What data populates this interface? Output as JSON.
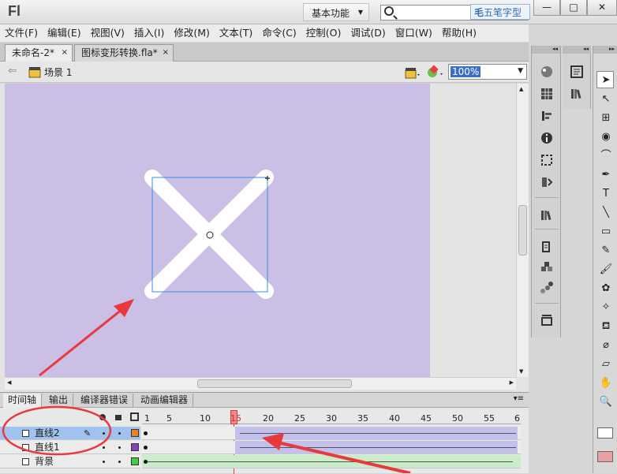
{
  "window": {
    "app_logo": "Fl",
    "workspace_label": "基本功能",
    "search_placeholder": "",
    "watermark": "五笔字型",
    "controls": {
      "minimize": "—",
      "maximize": "□",
      "close": "✕"
    }
  },
  "menubar": {
    "items": [
      "文件(F)",
      "编辑(E)",
      "视图(V)",
      "插入(I)",
      "修改(M)",
      "文本(T)",
      "命令(C)",
      "控制(O)",
      "调试(D)",
      "窗口(W)",
      "帮助(H)"
    ]
  },
  "doc_tabs": [
    {
      "label": "未命名-2*",
      "close": "×"
    },
    {
      "label": "图标变形转换.fla*",
      "close": "×"
    }
  ],
  "editbar": {
    "scene_label": "场景 1",
    "zoom": "100%"
  },
  "timeline": {
    "tabs": [
      "时间轴",
      "输出",
      "编译器错误",
      "动画编辑器"
    ],
    "ruler_numbers": [
      "1",
      "5",
      "10",
      "15",
      "20",
      "25",
      "30",
      "35",
      "40",
      "45",
      "50",
      "55",
      "6"
    ],
    "current_frame": "15",
    "layers": [
      {
        "name": "直线2",
        "color": "#e7861f",
        "selected": true
      },
      {
        "name": "直线1",
        "color": "#8b3dc4",
        "selected": false
      },
      {
        "name": "背景",
        "color": "#3fcf3f",
        "selected": false
      }
    ]
  },
  "colors": {
    "stage": "#cbbfe6",
    "annotation_red": "#e8393c",
    "selection_blue": "#3a8ee6"
  },
  "icons": {
    "tools": [
      "selection-tool-icon",
      "subselection-tool-icon",
      "free-transform-icon",
      "3d-rotation-icon",
      "lasso-icon",
      "pen-icon",
      "text-tool-icon",
      "line-tool-icon",
      "rectangle-tool-icon",
      "pencil-icon",
      "brush-icon",
      "deco-icon",
      "bone-icon",
      "paint-bucket-icon",
      "eyedropper-icon",
      "eraser-icon",
      "hand-icon",
      "zoom-icon"
    ]
  }
}
